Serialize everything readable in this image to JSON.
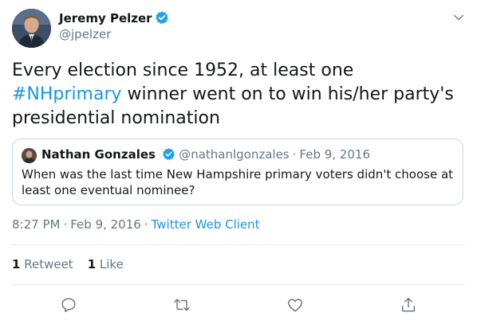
{
  "author": {
    "name": "Jeremy Pelzer",
    "handle": "@jpelzer",
    "verified": true,
    "avatar": "avatar-photo"
  },
  "menu_icon": "chevron-down-icon",
  "tweet": {
    "text_before": "Every election since 1952, at least one",
    "hashtag": "#NHprimary",
    "text_after": "winner went on to win his/her party's presidential nomination"
  },
  "quoted_tweet": {
    "author_name": "Nathan Gonzales",
    "author_handle": "@nathanlgonzales",
    "separator": "·",
    "date": "Feb 9, 2016",
    "text": "When was the last time New Hampshire primary voters didn't choose at least one eventual nominee?"
  },
  "meta": {
    "time": "8:27 PM",
    "separator": "·",
    "date": "Feb 9, 2016",
    "source": "Twitter Web Client"
  },
  "stats": {
    "retweets_count": "1",
    "retweets_label": "Retweet",
    "likes_count": "1",
    "likes_label": "Like"
  },
  "actions": [
    "reply-icon",
    "retweet-icon",
    "like-icon",
    "share-icon"
  ],
  "colors": {
    "link": "#1b95e0",
    "verified": "#1da1f2",
    "secondary_text": "#657786",
    "border": "#ccd6dd",
    "divider": "#e6ecf0"
  }
}
